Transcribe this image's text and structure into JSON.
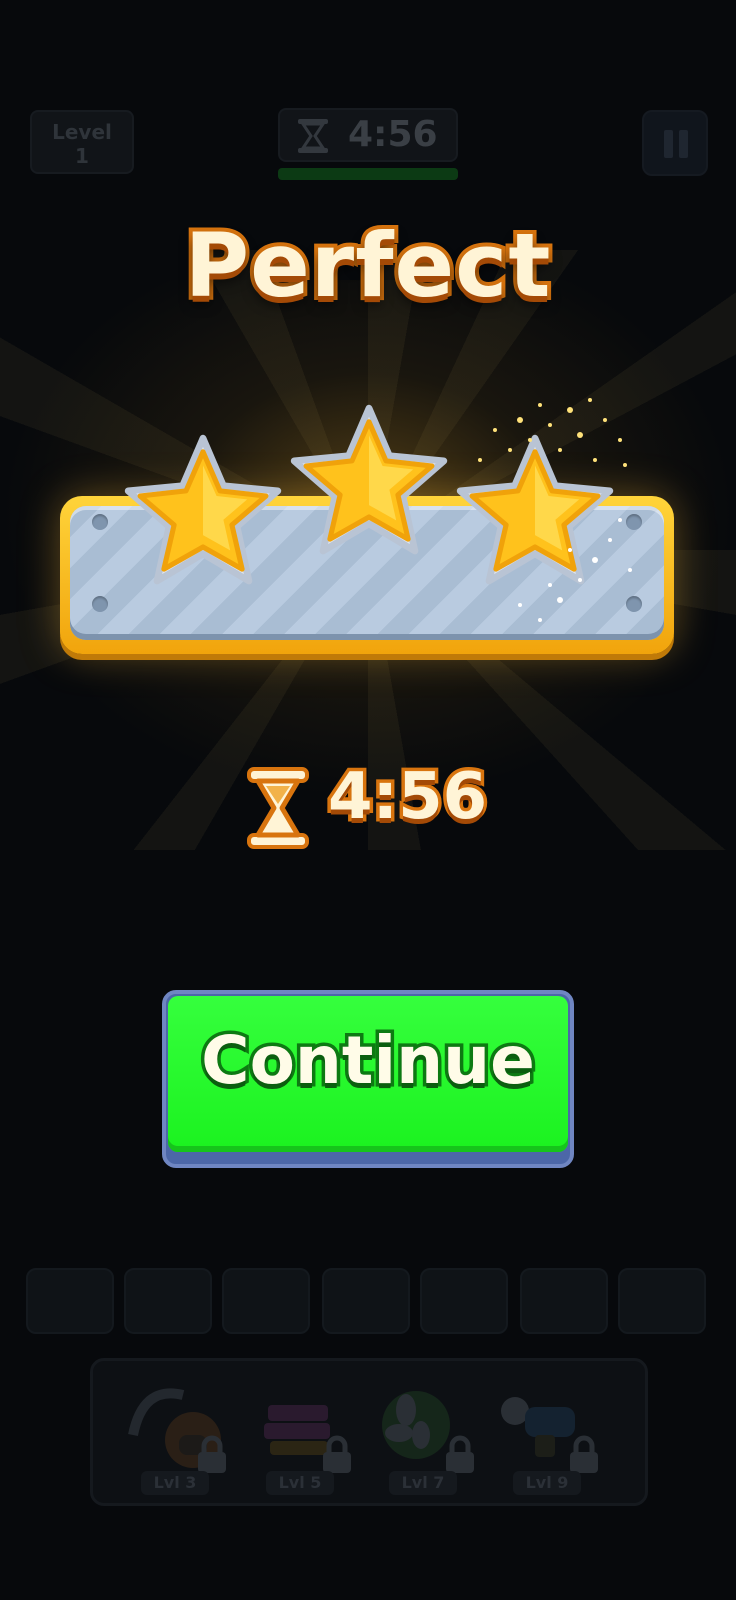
{
  "hud": {
    "level_label": "Level",
    "level_number": "1",
    "timer": "4:56"
  },
  "result": {
    "title": "Perfect",
    "stars_earned": 3,
    "stars_total": 3,
    "time": "4:56"
  },
  "continue_button": {
    "label": "Continue"
  },
  "tools": [
    {
      "icon": "vacuum-icon",
      "label": "Lvl 3",
      "locked": true
    },
    {
      "icon": "book-stack-icon",
      "label": "Lvl 5",
      "locked": true
    },
    {
      "icon": "fan-icon",
      "label": "Lvl 7",
      "locked": true
    },
    {
      "icon": "blaster-icon",
      "label": "Lvl 9",
      "locked": true
    }
  ],
  "colors": {
    "title_fill": "#fff4d6",
    "title_stroke": "#d8740e",
    "star": "#ffc21c",
    "continue_green": "#1bf21f",
    "background": "#07090c"
  }
}
